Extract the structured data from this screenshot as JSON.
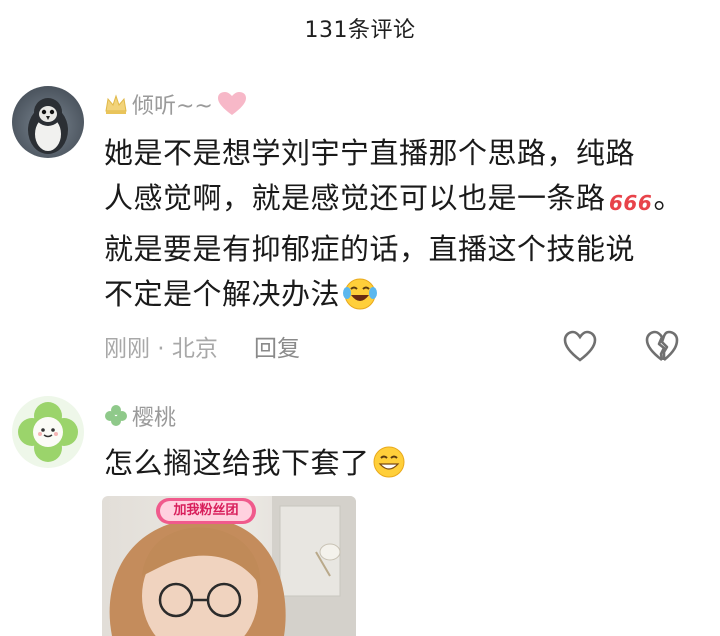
{
  "header": {
    "title": "131条评论"
  },
  "comments": [
    {
      "username": "倾听~~",
      "lines": [
        "她是不是想学刘宇宁直播那个思路，纯路",
        "人感觉啊，就是感觉还可以也是一条路",
        "就是要是有抑郁症的话，直播这个技能说",
        "不定是个解决办法"
      ],
      "line2_tail": "。",
      "meta_time": "刚刚 · 北京",
      "reply_label": "回复",
      "icons": [
        "crown-icon",
        "pink-heart-icon",
        "666-emoji-icon",
        "laughing-crying-emoji-icon",
        "like-heart-icon",
        "dislike-broken-heart-icon"
      ]
    },
    {
      "username": "樱桃",
      "lines": [
        "怎么搁这给我下套了"
      ],
      "icons": [
        "clover-icon",
        "grin-emoji-icon"
      ],
      "photo_badge": "加我粉丝团"
    }
  ],
  "colors": {
    "text": "#1a1a1a",
    "meta": "#a8a8a8",
    "username": "#9a9a9a",
    "pink": "#f7b8c8",
    "clover": "#8fc98a"
  }
}
